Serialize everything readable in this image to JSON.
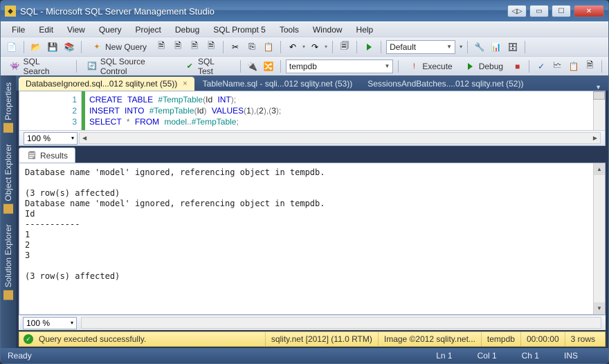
{
  "title": "SQL - Microsoft SQL Server Management Studio",
  "menus": [
    "File",
    "Edit",
    "View",
    "Query",
    "Project",
    "Debug",
    "SQL Prompt 5",
    "Tools",
    "Window",
    "Help"
  ],
  "toolbar1": {
    "new_query": "New Query",
    "config_combo": "Default"
  },
  "toolbar2": {
    "items": [
      "SQL Search",
      "SQL Source Control",
      "SQL Test"
    ],
    "db_combo": "tempdb",
    "execute": "Execute",
    "debug": "Debug"
  },
  "left_rail": [
    "Properties",
    "Object Explorer",
    "Solution Explorer"
  ],
  "tabs": [
    {
      "label": "DatabaseIgnored.sql...012 sqlity.net (55))",
      "active": true
    },
    {
      "label": "TableName.sql - sqli...012 sqlity.net (53))",
      "active": false
    },
    {
      "label": "SessionsAndBatches....012 sqlity.net (52))",
      "active": false
    }
  ],
  "code_lines": [
    "1",
    "2",
    "3"
  ],
  "code": {
    "l1a": "CREATE",
    "l1b": "TABLE",
    "l1c": "#TempTable",
    "l1d": "(",
    "l1e": "Id",
    "l1f": "INT",
    "l1g": ");",
    "l2a": "INSERT",
    "l2b": "INTO",
    "l2c": "#TempTable",
    "l2d": "(",
    "l2e": "Id",
    "l2f": ")",
    "l2g": "VALUES",
    "l2h": "(",
    "l2i": "1",
    "l2j": "),(",
    "l2k": "2",
    "l2l": "),(",
    "l2m": "3",
    "l2n": ");",
    "l3a": "SELECT",
    "l3b": "*",
    "l3c": "FROM",
    "l3d": "model",
    "l3e": "..",
    "l3f": "#TempTable",
    "l3g": ";"
  },
  "zoom": "100 %",
  "results_tab": "Results",
  "results_text": "Database name 'model' ignored, referencing object in tempdb.\n\n(3 row(s) affected)\nDatabase name 'model' ignored, referencing object in tempdb.\nId\n-----------\n1\n2\n3\n\n(3 row(s) affected)",
  "status_yellow": {
    "msg": "Query executed successfully.",
    "server": "sqlity.net [2012] (11.0 RTM)",
    "image": "Image ©2012 sqlity.net...",
    "db": "tempdb",
    "time": "00:00:00",
    "rows": "3 rows"
  },
  "status_bottom": {
    "ready": "Ready",
    "ln": "Ln 1",
    "col": "Col 1",
    "ch": "Ch 1",
    "ins": "INS"
  }
}
